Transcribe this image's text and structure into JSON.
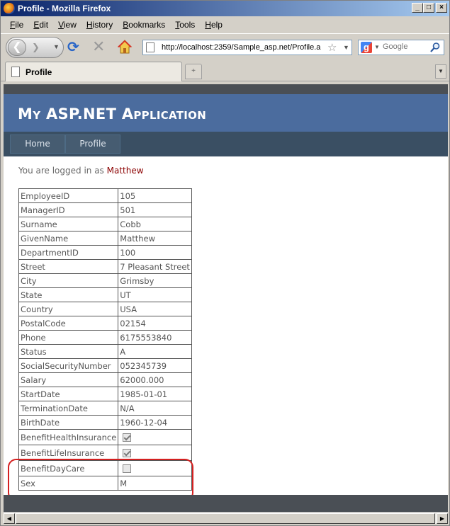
{
  "window": {
    "title": "Profile - Mozilla Firefox"
  },
  "menu": [
    {
      "label": "File",
      "key": "F",
      "rest": "ile"
    },
    {
      "label": "Edit",
      "key": "E",
      "rest": "dit"
    },
    {
      "label": "View",
      "key": "V",
      "rest": "iew"
    },
    {
      "label": "History",
      "key": "H",
      "rest": "istory"
    },
    {
      "label": "Bookmarks",
      "key": "B",
      "rest": "ookmarks"
    },
    {
      "label": "Tools",
      "key": "T",
      "rest": "ools"
    },
    {
      "label": "Help",
      "key": "H",
      "rest": "elp"
    }
  ],
  "toolbar": {
    "url": "http://localhost:2359/Sample_asp.net/Profile.a",
    "search_placeholder": "Google"
  },
  "tab": {
    "label": "Profile"
  },
  "page": {
    "app_title": "My ASP.NET Application",
    "nav": {
      "home": "Home",
      "profile": "Profile"
    },
    "logged_prefix": "You are logged in as",
    "username": "Matthew",
    "rows": [
      {
        "key": "EmployeeID",
        "value": "105"
      },
      {
        "key": "ManagerID",
        "value": "501"
      },
      {
        "key": "Surname",
        "value": "Cobb"
      },
      {
        "key": "GivenName",
        "value": "Matthew"
      },
      {
        "key": "DepartmentID",
        "value": "100"
      },
      {
        "key": "Street",
        "value": "7 Pleasant Street"
      },
      {
        "key": "City",
        "value": "Grimsby"
      },
      {
        "key": "State",
        "value": "UT"
      },
      {
        "key": "Country",
        "value": "USA"
      },
      {
        "key": "PostalCode",
        "value": "02154"
      },
      {
        "key": "Phone",
        "value": "6175553840"
      },
      {
        "key": "Status",
        "value": "A"
      },
      {
        "key": "SocialSecurityNumber",
        "value": "052345739"
      },
      {
        "key": "Salary",
        "value": "62000.000"
      },
      {
        "key": "StartDate",
        "value": "1985-01-01"
      },
      {
        "key": "TerminationDate",
        "value": "N/A"
      },
      {
        "key": "BirthDate",
        "value": "1960-12-04"
      }
    ],
    "checkbox_rows": [
      {
        "key": "BenefitHealthInsurance",
        "checked": true
      },
      {
        "key": "BenefitLifeInsurance",
        "checked": true
      },
      {
        "key": "BenefitDayCare",
        "checked": false
      }
    ],
    "last_row": {
      "key": "Sex",
      "value": "M"
    }
  },
  "colors": {
    "header": "#4b6c9e",
    "nav": "#3a4f63",
    "username": "#8b0000",
    "highlight": "#d42020"
  }
}
